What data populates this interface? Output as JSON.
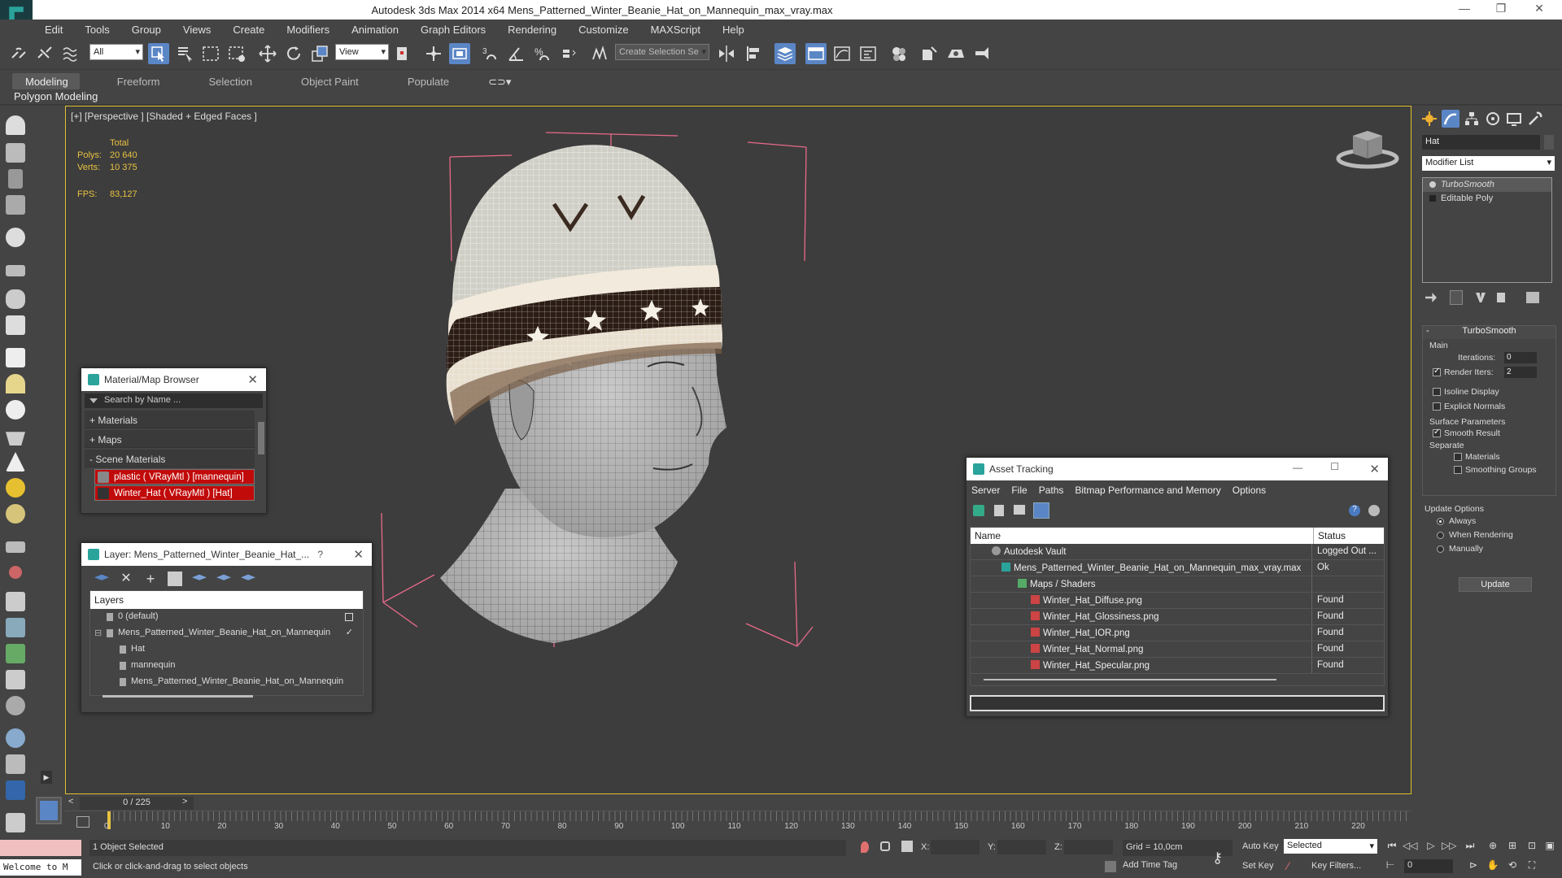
{
  "window": {
    "title": "Autodesk 3ds Max  2014 x64     Mens_Patterned_Winter_Beanie_Hat_on_Mannequin_max_vray.max"
  },
  "menu": [
    "Edit",
    "Tools",
    "Group",
    "Views",
    "Create",
    "Modifiers",
    "Animation",
    "Graph Editors",
    "Rendering",
    "Customize",
    "MAXScript",
    "Help"
  ],
  "toolbar": {
    "filter_value": "All",
    "refcoord_value": "View",
    "selection_set_placeholder": "Create Selection Se"
  },
  "ribbon": {
    "tabs": [
      "Modeling",
      "Freeform",
      "Selection",
      "Object Paint",
      "Populate"
    ],
    "active_tab": "Modeling",
    "panel_label": "Polygon Modeling"
  },
  "viewport": {
    "label": "[+] [Perspective ] [Shaded + Edged Faces ]",
    "stats": {
      "header": "Total",
      "polys_label": "Polys:",
      "polys_value": "20 640",
      "verts_label": "Verts:",
      "verts_value": "10 375",
      "fps_label": "FPS:",
      "fps_value": "83,127"
    }
  },
  "material_browser": {
    "title": "Material/Map Browser",
    "search_placeholder": "Search by Name ...",
    "groups": [
      "+ Materials",
      "+ Maps",
      "- Scene Materials"
    ],
    "items": [
      "plastic  ( VRayMtl ) [mannequin]",
      "Winter_Hat  ( VRayMtl ) [Hat]"
    ]
  },
  "layer_panel": {
    "title": "Layer: Mens_Patterned_Winter_Beanie_Hat_...",
    "help": "?",
    "header": "Layers",
    "rows": [
      "0 (default)",
      "Mens_Patterned_Winter_Beanie_Hat_on_Mannequin",
      "Hat",
      "mannequin",
      "Mens_Patterned_Winter_Beanie_Hat_on_Mannequin"
    ]
  },
  "asset_tracking": {
    "title": "Asset Tracking",
    "menu": [
      "Server",
      "File",
      "Paths",
      "Bitmap Performance and Memory",
      "Options"
    ],
    "columns": [
      "Name",
      "Status"
    ],
    "rows": [
      {
        "name": "Autodesk Vault",
        "status": "Logged Out ..."
      },
      {
        "name": "Mens_Patterned_Winter_Beanie_Hat_on_Mannequin_max_vray.max",
        "status": "Ok"
      },
      {
        "name": "Maps / Shaders",
        "status": ""
      },
      {
        "name": "Winter_Hat_Diffuse.png",
        "status": "Found"
      },
      {
        "name": "Winter_Hat_Glossiness.png",
        "status": "Found"
      },
      {
        "name": "Winter_Hat_IOR.png",
        "status": "Found"
      },
      {
        "name": "Winter_Hat_Normal.png",
        "status": "Found"
      },
      {
        "name": "Winter_Hat_Specular.png",
        "status": "Found"
      }
    ]
  },
  "command_panel": {
    "object_name": "Hat",
    "modifier_list": "Modifier List",
    "stack": [
      "TurboSmooth",
      "Editable Poly"
    ],
    "rollout_title": "TurboSmooth",
    "main_group": "Main",
    "iterations_label": "Iterations:",
    "iterations_value": "0",
    "render_iters_label": "Render Iters:",
    "render_iters_value": "2",
    "isoline_label": "Isoline Display",
    "explicit_normals_label": "Explicit Normals",
    "surface_group": "Surface Parameters",
    "smooth_result_label": "Smooth Result",
    "separate_label": "Separate",
    "materials_label": "Materials",
    "smoothing_groups_label": "Smoothing Groups",
    "update_group": "Update Options",
    "always_label": "Always",
    "when_rendering_label": "When Rendering",
    "manually_label": "Manually",
    "update_button": "Update"
  },
  "timeline": {
    "slider_text": "0 / 225",
    "ticks": [
      "0",
      "10",
      "20",
      "30",
      "40",
      "50",
      "60",
      "70",
      "80",
      "90",
      "100",
      "110",
      "120",
      "130",
      "140",
      "150",
      "160",
      "170",
      "180",
      "190",
      "200",
      "210",
      "220"
    ]
  },
  "status": {
    "maxscript_listener": "Welcome to M",
    "selection": "1 Object Selected",
    "prompt": "Click or click-and-drag to select objects",
    "x_label": "X:",
    "y_label": "Y:",
    "z_label": "Z:",
    "grid": "Grid = 10,0cm",
    "add_time_tag": "Add Time Tag",
    "auto_key": "Auto Key",
    "set_key": "Set Key",
    "selected_dropdown": "Selected",
    "key_filters": "Key Filters...",
    "frame": "0"
  },
  "colors": {
    "accent": "#5b86c6",
    "stats_text": "#e8c240",
    "viewport_border": "#e0c030",
    "material_highlight": "#c10a0a",
    "app_teal": "#2aa39b"
  }
}
